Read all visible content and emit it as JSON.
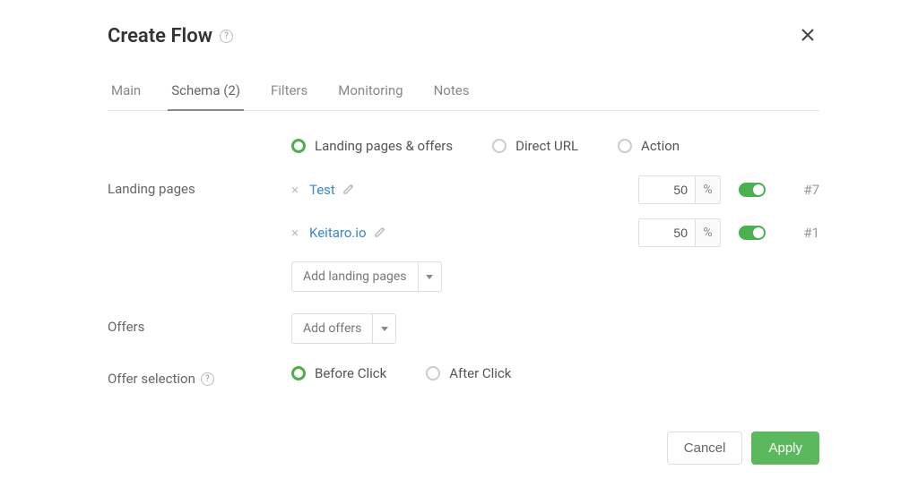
{
  "header": {
    "title": "Create Flow"
  },
  "tabs": {
    "main": "Main",
    "schema": "Schema (2)",
    "filters": "Filters",
    "monitoring": "Monitoring",
    "notes": "Notes"
  },
  "schema_type": {
    "landing_offers": "Landing pages & offers",
    "direct_url": "Direct URL",
    "action": "Action"
  },
  "labels": {
    "landing_pages": "Landing pages",
    "offers": "Offers",
    "offer_selection": "Offer selection"
  },
  "landing_pages": [
    {
      "name": "Test",
      "weight": "50",
      "id": "#7",
      "enabled": true
    },
    {
      "name": "Keitaro.io",
      "weight": "50",
      "id": "#1",
      "enabled": true
    }
  ],
  "buttons": {
    "add_landing_pages": "Add landing pages",
    "add_offers": "Add offers",
    "cancel": "Cancel",
    "apply": "Apply"
  },
  "offer_selection": {
    "before": "Before Click",
    "after": "After Click"
  },
  "symbols": {
    "percent": "%"
  }
}
